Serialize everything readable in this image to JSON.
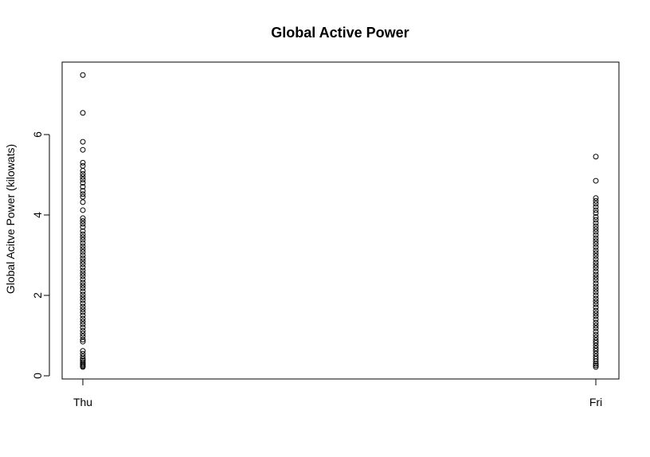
{
  "chart_data": {
    "type": "scatter",
    "title": "Global Active Power",
    "xlabel": "",
    "ylabel": "Global Acitve Power (kilowats)",
    "x_categories": [
      "Thu",
      "Fri"
    ],
    "xlim": [
      0,
      1
    ],
    "ylim": [
      0,
      7.5
    ],
    "yticks": [
      0,
      2,
      4,
      6
    ],
    "grid": false,
    "legend": "none",
    "series": [
      {
        "x": 0,
        "values": [
          7.48,
          6.54,
          5.82,
          5.62,
          5.3,
          5.22,
          5.1,
          5.02,
          4.95,
          4.88,
          4.8,
          4.7,
          4.6,
          4.52,
          4.45,
          4.32,
          4.12,
          3.92,
          3.85,
          3.78,
          3.7,
          3.6,
          3.52,
          3.45,
          3.38,
          3.3,
          3.22,
          3.15,
          3.08,
          3.0,
          2.92,
          2.85,
          2.78,
          2.7,
          2.62,
          2.55,
          2.48,
          2.4,
          2.32,
          2.25,
          2.18,
          2.1,
          2.02,
          1.95,
          1.88,
          1.8,
          1.72,
          1.65,
          1.58,
          1.5,
          1.42,
          1.35,
          1.28,
          1.2,
          1.12,
          1.05,
          0.98,
          0.9,
          0.85,
          0.62,
          0.55,
          0.48,
          0.42,
          0.38,
          0.34,
          0.3,
          0.27,
          0.24,
          0.22
        ]
      },
      {
        "x": 1,
        "values": [
          5.45,
          4.85,
          4.42,
          4.35,
          4.28,
          4.2,
          4.12,
          4.05,
          3.95,
          3.88,
          3.8,
          3.72,
          3.65,
          3.58,
          3.5,
          3.42,
          3.35,
          3.28,
          3.2,
          3.12,
          3.05,
          2.98,
          2.9,
          2.82,
          2.75,
          2.68,
          2.6,
          2.52,
          2.45,
          2.38,
          2.3,
          2.22,
          2.15,
          2.08,
          2.0,
          1.92,
          1.85,
          1.78,
          1.7,
          1.62,
          1.55,
          1.48,
          1.4,
          1.32,
          1.25,
          1.18,
          1.1,
          1.02,
          0.95,
          0.88,
          0.82,
          0.75,
          0.68,
          0.62,
          0.55,
          0.48,
          0.42,
          0.36,
          0.3,
          0.26,
          0.22
        ]
      }
    ]
  }
}
